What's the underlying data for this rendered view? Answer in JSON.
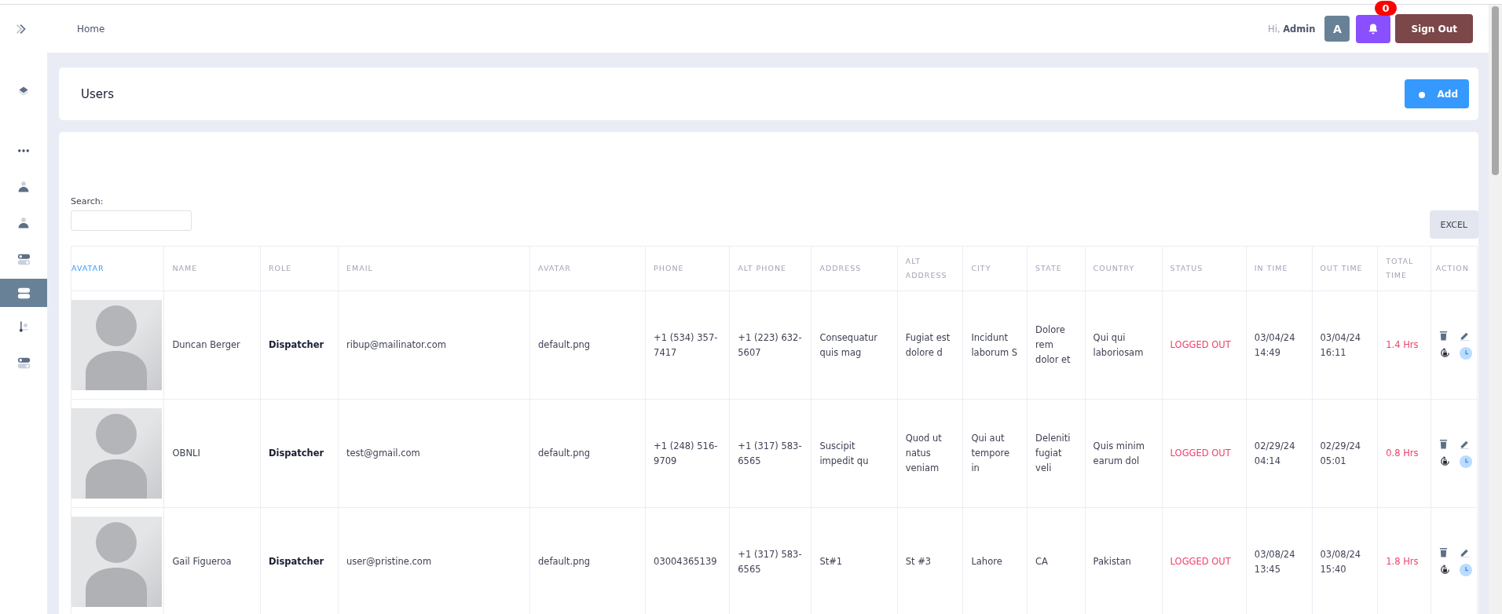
{
  "header": {
    "breadcrumb": "Home",
    "greeting": "Hi,",
    "user": "Admin",
    "avatar_letter": "A",
    "notification_count": "0",
    "sign_out": "Sign Out"
  },
  "sidebar": {
    "items": [
      {
        "kind": "layers",
        "selected": false
      },
      {
        "kind": "dots",
        "selected": false
      },
      {
        "kind": "person",
        "selected": false
      },
      {
        "kind": "person",
        "selected": false
      },
      {
        "kind": "toggle",
        "selected": false
      },
      {
        "kind": "toggle",
        "selected": true
      },
      {
        "kind": "tree",
        "selected": false
      },
      {
        "kind": "toggle",
        "selected": false
      }
    ]
  },
  "page": {
    "title": "Users",
    "add_button": "Add"
  },
  "table_tools": {
    "search_label": "Search:",
    "export_button": "EXCEL"
  },
  "table": {
    "columns": [
      {
        "label": "AVATAR",
        "sorted": true
      },
      {
        "label": "NAME",
        "sorted": false
      },
      {
        "label": "ROLE",
        "sorted": false
      },
      {
        "label": "EMAIL",
        "sorted": false
      },
      {
        "label": "AVATAR",
        "sorted": false
      },
      {
        "label": "PHONE",
        "sorted": false
      },
      {
        "label": "ALT PHONE",
        "sorted": false
      },
      {
        "label": "ADDRESS",
        "sorted": false
      },
      {
        "label": "ALT ADDRESS",
        "sorted": false
      },
      {
        "label": "CITY",
        "sorted": false
      },
      {
        "label": "STATE",
        "sorted": false
      },
      {
        "label": "COUNTRY",
        "sorted": false
      },
      {
        "label": "STATUS",
        "sorted": false
      },
      {
        "label": "IN TIME",
        "sorted": false
      },
      {
        "label": "OUT TIME",
        "sorted": false
      },
      {
        "label": "TOTAL TIME",
        "sorted": false
      },
      {
        "label": "ACTION",
        "sorted": false
      }
    ],
    "rows": [
      {
        "name": "Duncan Berger",
        "role": "Dispatcher",
        "email": "ribup@mailinator.com",
        "avatar_file": "default.png",
        "phone": "+1 (534) 357-7417",
        "alt_phone": "+1 (223) 632-5607",
        "address": "Consequatur quis mag",
        "alt_address": "Fugiat est dolore d",
        "city": "Incidunt laborum S",
        "state": "Dolore rem dolor et",
        "country": "Qui qui laboriosam",
        "status": "LOGGED OUT",
        "in_time": "03/04/24 14:49",
        "out_time": "03/04/24 16:11",
        "total_time": "1.4 Hrs"
      },
      {
        "name": "OBNLI",
        "role": "Dispatcher",
        "email": "test@gmail.com",
        "avatar_file": "default.png",
        "phone": "+1 (248) 516-9709",
        "alt_phone": "+1 (317) 583-6565",
        "address": "Suscipit impedit qu",
        "alt_address": "Quod ut natus veniam",
        "city": "Qui aut tempore in",
        "state": "Deleniti fugiat veli",
        "country": "Quis minim earum dol",
        "status": "LOGGED OUT",
        "in_time": "02/29/24 04:14",
        "out_time": "02/29/24 05:01",
        "total_time": "0.8 Hrs"
      },
      {
        "name": "Gail Figueroa",
        "role": "Dispatcher",
        "email": "user@pristine.com",
        "avatar_file": "default.png",
        "phone": "03004365139",
        "alt_phone": "+1 (317) 583-6565",
        "address": "St#1",
        "alt_address": "St #3",
        "city": "Lahore",
        "state": "CA",
        "country": "Pakistan",
        "status": "LOGGED OUT",
        "in_time": "03/08/24 13:45",
        "out_time": "03/08/24 15:40",
        "total_time": "1.8 Hrs"
      }
    ]
  }
}
